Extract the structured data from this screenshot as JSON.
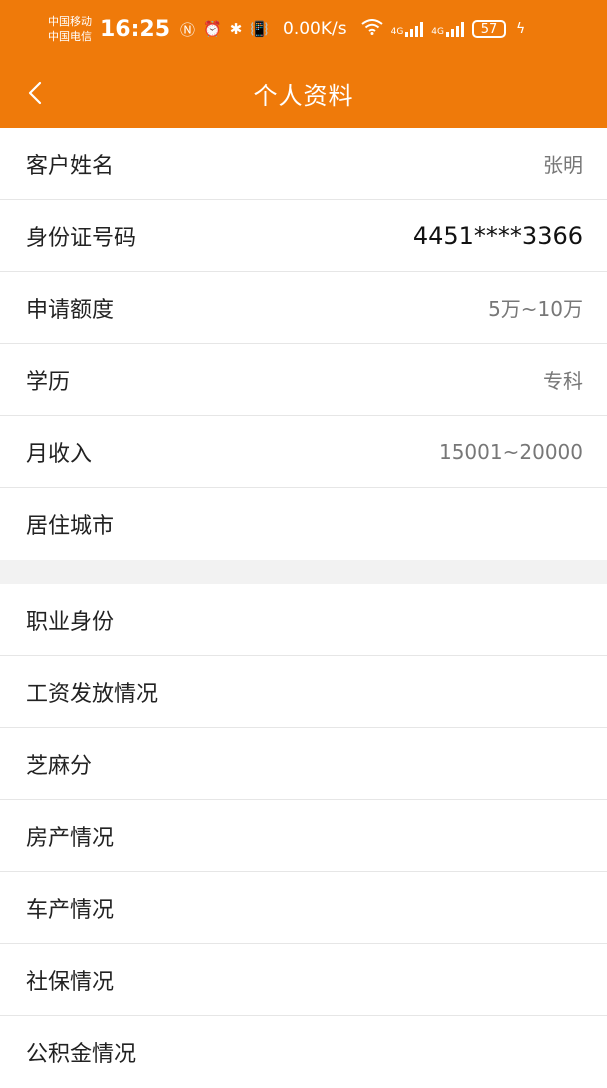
{
  "status_bar": {
    "carrier_1": "中国移动",
    "carrier_2": "中国电信",
    "time": "16:25",
    "speed": "0.00K/s",
    "network_1": "4G",
    "network_2": "4G",
    "battery": "57"
  },
  "nav": {
    "title": "个人资料"
  },
  "sections": [
    {
      "rows": [
        {
          "label": "客户姓名",
          "value": "张明"
        },
        {
          "label": "身份证号码",
          "value": "4451****3366"
        },
        {
          "label": "申请额度",
          "value": "5万~10万"
        },
        {
          "label": "学历",
          "value": "专科"
        },
        {
          "label": "月收入",
          "value": "15001~20000"
        },
        {
          "label": "居住城市",
          "value": ""
        }
      ]
    },
    {
      "rows": [
        {
          "label": "职业身份",
          "value": ""
        },
        {
          "label": "工资发放情况",
          "value": ""
        },
        {
          "label": "芝麻分",
          "value": ""
        },
        {
          "label": "房产情况",
          "value": ""
        },
        {
          "label": "车产情况",
          "value": ""
        },
        {
          "label": "社保情况",
          "value": ""
        },
        {
          "label": "公积金情况",
          "value": ""
        }
      ]
    }
  ],
  "colors": {
    "header": "#ef7a0a",
    "background": "#f2f2f2"
  }
}
